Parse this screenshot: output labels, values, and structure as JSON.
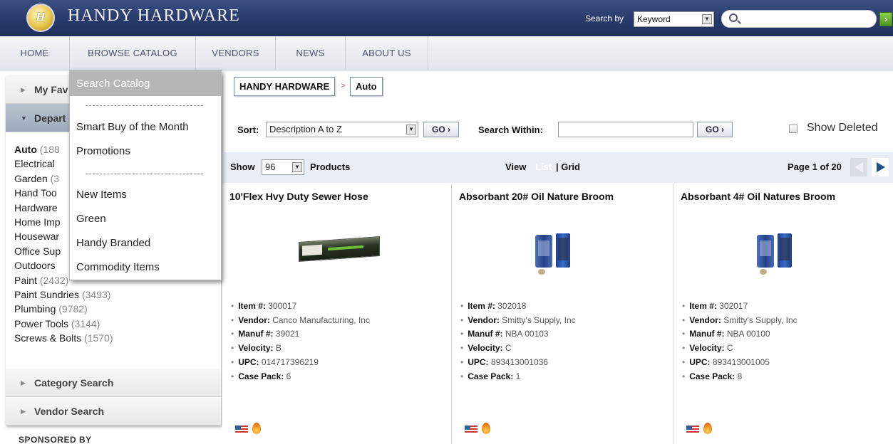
{
  "header": {
    "logo_letter": "H",
    "brand": "HANDY HARDWARE",
    "search_by_label": "Search by",
    "search_by_value": "Keyword",
    "search_go": "›"
  },
  "nav": [
    "HOME",
    "BROWSE CATALOG",
    "VENDORS",
    "NEWS",
    "ABOUT US"
  ],
  "dropdown": {
    "items": [
      "Search Catalog",
      "Smart Buy of the Month",
      "Promotions",
      "New Items",
      "Green",
      "Handy Branded",
      "Commodity Items"
    ]
  },
  "sidebar": {
    "my_favorites": "My Fav",
    "departments": "Depart",
    "category_search": "Category Search",
    "vendor_search": "Vendor Search",
    "dept_items": [
      {
        "name": "Auto",
        "count": "(188"
      },
      {
        "name": "Electrical",
        "count": ""
      },
      {
        "name": "Garden",
        "count": "(3"
      },
      {
        "name": "Hand Too",
        "count": ""
      },
      {
        "name": "Hardware",
        "count": ""
      },
      {
        "name": "Home Imp",
        "count": ""
      },
      {
        "name": "Housewar",
        "count": ""
      },
      {
        "name": "Office Sup",
        "count": ""
      },
      {
        "name": "Outdoors",
        "count": ""
      },
      {
        "name": "Paint",
        "count": "(2432)"
      },
      {
        "name": "Paint Sundries",
        "count": "(3493)"
      },
      {
        "name": "Plumbing",
        "count": "(9782)"
      },
      {
        "name": "Power Tools",
        "count": "(3144)"
      },
      {
        "name": "Screws & Bolts",
        "count": "(1570)"
      }
    ],
    "sponsored": "SPONSORED BY"
  },
  "breadcrumb": [
    "HANDY HARDWARE",
    "Auto"
  ],
  "breadcrumb_sep": ">",
  "sort": {
    "label": "Sort:",
    "value": "Description A to Z",
    "go": "GO",
    "within_label": "Search Within:",
    "show_deleted": "Show Deleted"
  },
  "showbar": {
    "show_label": "Show",
    "per_page": "96",
    "products_label": "Products",
    "view_label": "View",
    "view_list": "List",
    "view_grid": "| Grid",
    "page_label": "Page 1 of 20"
  },
  "products": [
    {
      "title": "10'Flex Hvy Duty Sewer Hose",
      "item": "300017",
      "vendor": "Canco Manufacturing, Inc",
      "manuf": "39021",
      "velocity": "B",
      "upc": "014717396219",
      "case_pack": "6"
    },
    {
      "title": "Absorbant 20# Oil Nature Broom",
      "item": "302018",
      "vendor": "Smitty's Supply, Inc",
      "manuf": "NBA 00103",
      "velocity": "C",
      "upc": "893413001036",
      "case_pack": "1"
    },
    {
      "title": "Absorbant 4# Oil Natures Broom",
      "item": "302017",
      "vendor": "Smitty's Supply, Inc",
      "manuf": "NBA 00100",
      "velocity": "C",
      "upc": "893413001005",
      "case_pack": "8"
    }
  ],
  "spec_labels": {
    "item": "Item #:",
    "vendor": "Vendor:",
    "manuf": "Manuf #:",
    "velocity": "Velocity:",
    "upc": "UPC:",
    "case_pack": "Case Pack:"
  },
  "colors": {
    "header": "#27396a",
    "go_green": "#4c9620",
    "pager_blue": "#1f4f86"
  }
}
